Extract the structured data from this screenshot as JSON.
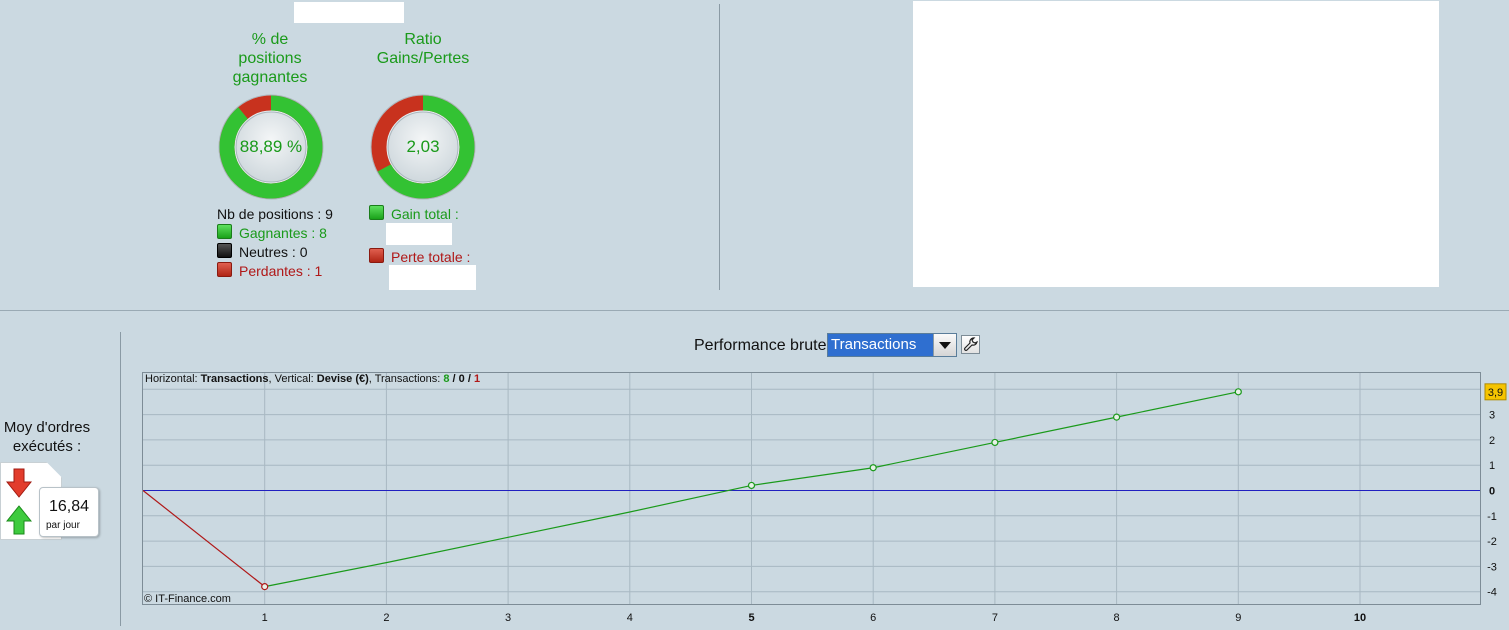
{
  "stats": {
    "win_title": "% de positions gagnantes",
    "win_value": "88,89 %",
    "win_fraction": 0.8889,
    "ratio_title": "Ratio Gains/Pertes",
    "ratio_value": "2,03",
    "ratio_fraction": 0.67,
    "nb_positions": "Nb de positions : 9",
    "gagnantes": "Gagnantes : 8",
    "neutres": "Neutres : 0",
    "perdantes": "Perdantes : 1",
    "gain_total": "Gain total :",
    "perte_totale": "Perte totale :"
  },
  "orders": {
    "title": "Moy d'ordres exécutés :",
    "value": "16,84",
    "unit": "par jour"
  },
  "performance": {
    "label": "Performance brute",
    "selected": "Transactions"
  },
  "chart_header": {
    "h_prefix": "Horizontal: ",
    "h_value": "Transactions",
    "v_prefix": ", Vertical: ",
    "v_value": "Devise (€)",
    "t_prefix": ", Transactions: ",
    "wins": "8",
    "sep1": " / ",
    "neutral": "0",
    "sep2": " / ",
    "losses": "1"
  },
  "copyright": "© IT-Finance.com",
  "colors": {
    "green": "#1a9a1a",
    "red": "#b01818",
    "zero_line": "#2020c0",
    "highlight": "#f5c400"
  },
  "chart_data": {
    "type": "line",
    "x": [
      0,
      1,
      2,
      3,
      4,
      5,
      6,
      7,
      8,
      9
    ],
    "y_losing_segment": [
      0,
      -3.8
    ],
    "y": [
      0,
      -3.8,
      -2.85,
      -1.85,
      -0.85,
      0.2,
      0.9,
      1.9,
      2.9,
      3.9
    ],
    "markers_x": [
      1,
      5,
      6,
      7,
      8,
      9
    ],
    "markers_y": [
      -3.8,
      0.2,
      0.9,
      1.9,
      2.9,
      3.9
    ],
    "xlim": [
      0,
      10
    ],
    "ylim": [
      -4.3,
      4.3
    ],
    "x_ticks": [
      "1",
      "2",
      "3",
      "4",
      "5",
      "6",
      "7",
      "8",
      "9",
      "10"
    ],
    "x_ticks_bold": [
      "5",
      "10"
    ],
    "y_ticks": [
      "3",
      "2",
      "1",
      "0",
      "-1",
      "-2",
      "-3",
      "-4"
    ],
    "y_tick_values": [
      3,
      2,
      1,
      0,
      -1,
      -2,
      -3,
      -4
    ],
    "last_value_label": "3,9",
    "grid": true
  }
}
